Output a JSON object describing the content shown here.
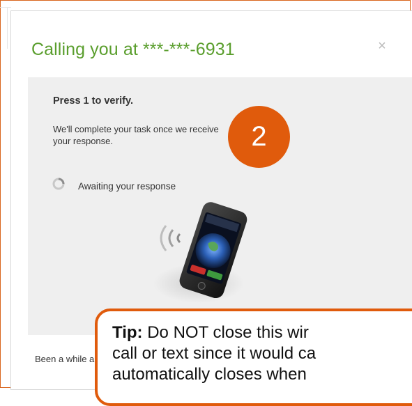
{
  "dialog": {
    "title": "Calling you at ***-***-6931",
    "close_label": "×"
  },
  "panel": {
    "heading": "Press 1 to verify.",
    "description": "We'll complete your task once we receive your response.",
    "status": "Awaiting your response"
  },
  "callout": {
    "number": "2"
  },
  "footer": {
    "text": "Been a while a"
  },
  "tip": {
    "label": "Tip:",
    "line1": "Do NOT close this wir",
    "line2": "call or text since it would ca",
    "line3": "automatically closes when"
  },
  "colors": {
    "accent": "#e05b0c",
    "title_green": "#5a9e2d"
  }
}
